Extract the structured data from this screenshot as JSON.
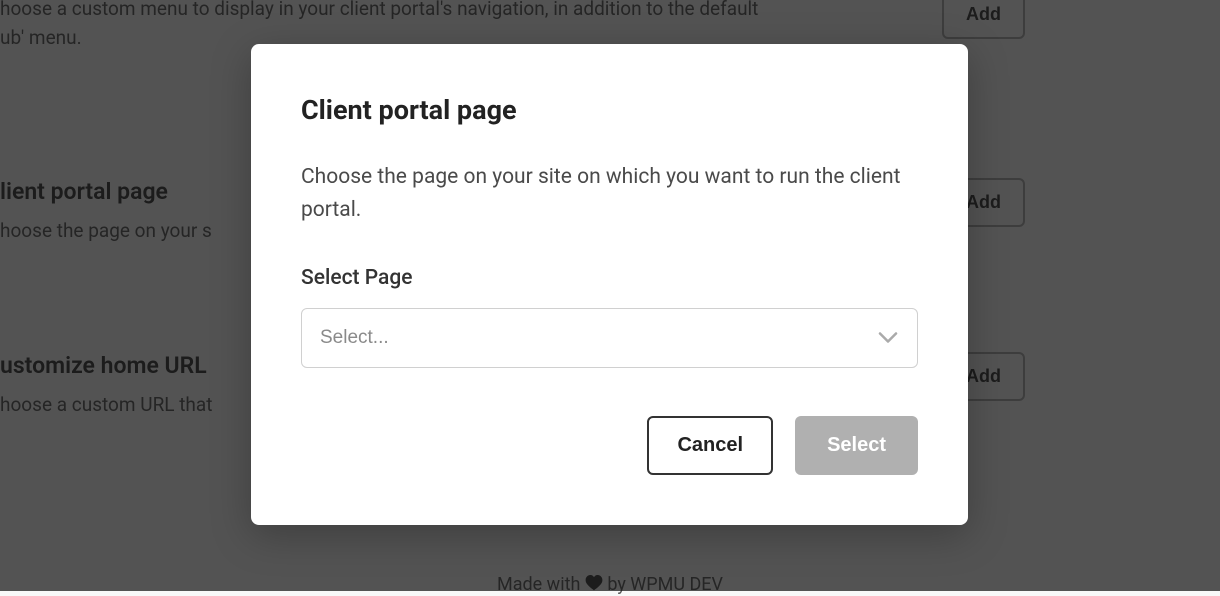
{
  "bg": {
    "section1": {
      "desc_line1": "hoose a custom menu to display in your client portal's navigation, in addition to the default",
      "desc_line2": "ub' menu.",
      "add": "Add"
    },
    "section2": {
      "heading": "lient portal page",
      "desc": "hoose the page on your s",
      "add": "Add"
    },
    "section3": {
      "heading": "ustomize home URL",
      "desc": "hoose a custom URL that",
      "add": "Add"
    },
    "footer": {
      "made_with": "Made with ",
      "by": " by WPMU DEV"
    }
  },
  "modal": {
    "title": "Client portal page",
    "description": "Choose the page on your site on which you want to run the client portal.",
    "field_label": "Select Page",
    "select_placeholder": "Select...",
    "cancel": "Cancel",
    "select_btn": "Select"
  }
}
